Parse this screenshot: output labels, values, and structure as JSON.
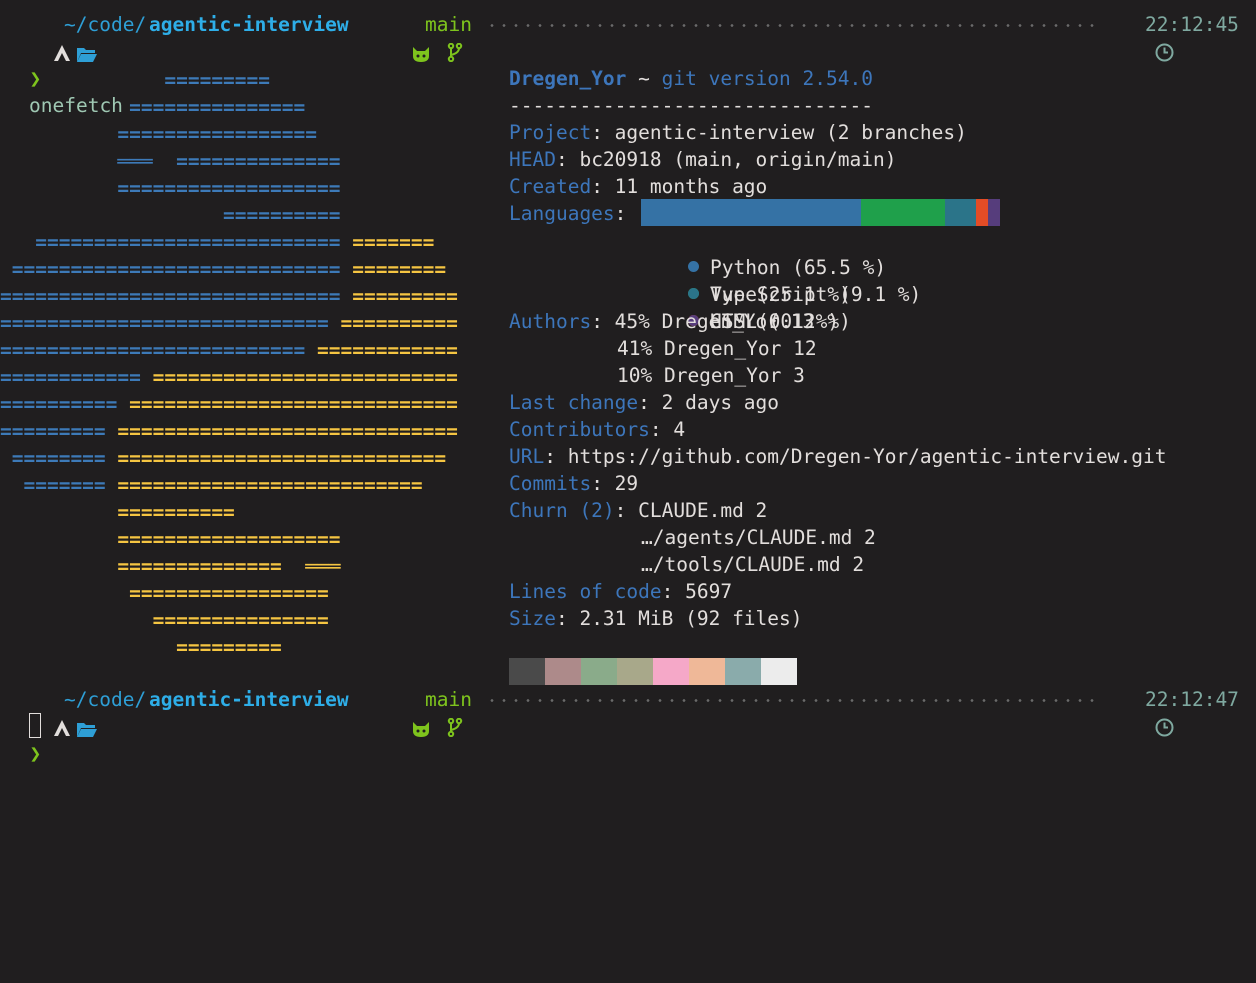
{
  "prompt1": {
    "path_prefix": "~/code/",
    "path_name": "agentic-interview",
    "branch": "main",
    "time": "22:12:45"
  },
  "command": "onefetch",
  "ascii_art": [
    [
      {
        "t": "              =========",
        "c": "blue"
      }
    ],
    [
      {
        "t": "           ===============",
        "c": "blue"
      }
    ],
    [
      {
        "t": "          =================",
        "c": "blue"
      }
    ],
    [
      {
        "t": "          ",
        "c": "blue"
      },
      {
        "t": "═══",
        "c": "blue"
      },
      {
        "t": "  ==============",
        "c": "blue"
      }
    ],
    [
      {
        "t": "          ===================",
        "c": "blue"
      }
    ],
    [
      {
        "t": "                   ==========",
        "c": "blue"
      }
    ],
    [
      {
        "t": "   ==========================",
        "c": "blue"
      },
      {
        "t": " =======",
        "c": "yellow"
      }
    ],
    [
      {
        "t": " ============================",
        "c": "blue"
      },
      {
        "t": " ========",
        "c": "yellow"
      }
    ],
    [
      {
        "t": "=============================",
        "c": "blue"
      },
      {
        "t": " =========",
        "c": "yellow"
      }
    ],
    [
      {
        "t": "============================",
        "c": "blue"
      },
      {
        "t": " ==========",
        "c": "yellow"
      }
    ],
    [
      {
        "t": "==========================",
        "c": "blue"
      },
      {
        "t": " ============",
        "c": "yellow"
      }
    ],
    [
      {
        "t": "============",
        "c": "blue"
      },
      {
        "t": " ==========================",
        "c": "yellow"
      }
    ],
    [
      {
        "t": "==========",
        "c": "blue"
      },
      {
        "t": " ============================",
        "c": "yellow"
      }
    ],
    [
      {
        "t": "=========",
        "c": "blue"
      },
      {
        "t": " =============================",
        "c": "yellow"
      }
    ],
    [
      {
        "t": " ========",
        "c": "blue"
      },
      {
        "t": " ============================",
        "c": "yellow"
      }
    ],
    [
      {
        "t": "  =======",
        "c": "blue"
      },
      {
        "t": " ==========================",
        "c": "yellow"
      }
    ],
    [
      {
        "t": "          ==========",
        "c": "yellow"
      }
    ],
    [
      {
        "t": "          ===================",
        "c": "yellow"
      }
    ],
    [
      {
        "t": "          ==============  ═══",
        "c": "yellow"
      }
    ],
    [
      {
        "t": "           =================",
        "c": "yellow"
      }
    ],
    [
      {
        "t": "             ===============",
        "c": "yellow"
      }
    ],
    [
      {
        "t": "               =========",
        "c": "yellow"
      }
    ]
  ],
  "info": {
    "user": "Dregen_Yor",
    "tilde": " ~ ",
    "git_version": "git version 2.54.0",
    "separator": "-------------------------------",
    "project_key": "Project",
    "project_val": ": agentic-interview (2 branches)",
    "head_key": "HEAD",
    "head_val": ": bc20918 (main, origin/main)",
    "created_key": "Created",
    "created_val": ": 11 months ago",
    "languages_key": "Languages",
    "languages_colon": ":",
    "languages": [
      {
        "name": "Python (65.5 %)",
        "percent": 65.5,
        "color": "#3572A5"
      },
      {
        "name": "Vue (25.1 %)",
        "percent": 25.1,
        "color": "#1fa04b"
      },
      {
        "name": "TypeScript (9.1 %)",
        "percent": 9.1,
        "color": "#2b7489"
      },
      {
        "name": "HTML (0.2 %)",
        "percent": 0.2,
        "color": "#e34c26"
      },
      {
        "name": "CSS (0.1 %)",
        "percent": 0.1,
        "color": "#563d7c"
      }
    ],
    "authors_key": "Authors",
    "authors": [
      {
        "line": "45% Dregen_Yor 13"
      },
      {
        "line": "41% Dregen_Yor 12"
      },
      {
        "line": "10% Dregen_Yor 3"
      }
    ],
    "last_change_key": "Last change",
    "last_change_val": ": 2 days ago",
    "contributors_key": "Contributors",
    "contributors_val": ": 4",
    "url_key": "URL",
    "url_val": ": https://github.com/Dregen-Yor/agentic-interview.git",
    "commits_key": "Commits",
    "commits_val": ": 29",
    "churn_key": "Churn (2)",
    "churn": [
      ": CLAUDE.md 2",
      "…/agents/CLAUDE.md 2",
      "…/tools/CLAUDE.md 2"
    ],
    "loc_key": "Lines of code",
    "loc_val": ": 5697",
    "size_key": "Size",
    "size_val": ": 2.31 MiB (92 files)"
  },
  "palette": [
    "#4a4a4a",
    "#ad8a8a",
    "#8aab8a",
    "#a8a88a",
    "#f5a8c8",
    "#efb898",
    "#8aabab",
    "#ececec"
  ],
  "prompt2": {
    "path_prefix": "~/code/",
    "path_name": "agentic-interview",
    "branch": "main",
    "time": "22:12:47"
  },
  "prompt_char": "❯"
}
